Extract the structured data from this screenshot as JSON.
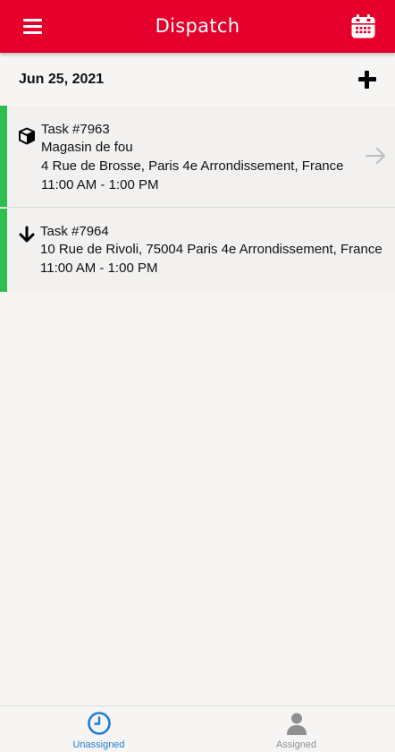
{
  "header": {
    "title": "Dispatch",
    "menu_icon": "menu-icon",
    "calendar_icon": "calendar-icon",
    "color": "#e5002b"
  },
  "date_row": {
    "date": "Jun 25, 2021",
    "add_icon": "plus-icon"
  },
  "tasks": [
    {
      "title": "Task #7963",
      "name": "Magasin de fou",
      "address": "4 Rue de Brosse, Paris 4e Arrondissement, France",
      "time": "11:00 AM - 1:00 PM",
      "type_icon": "package-icon",
      "status_color": "#2dbe4f"
    },
    {
      "title": "Task #7964",
      "address": "10 Rue de Rivoli, 75004 Paris 4e Arrondissement, France",
      "time": "11:00 AM - 1:00 PM",
      "type_icon": "arrow-down-icon",
      "status_color": "#2dbe4f"
    }
  ],
  "tabs": [
    {
      "label": "Unassigned",
      "icon": "clock-icon",
      "active": true,
      "color": "#1e7bd6"
    },
    {
      "label": "Assigned",
      "icon": "person-icon",
      "active": false,
      "color": "#8f8f8f"
    }
  ]
}
